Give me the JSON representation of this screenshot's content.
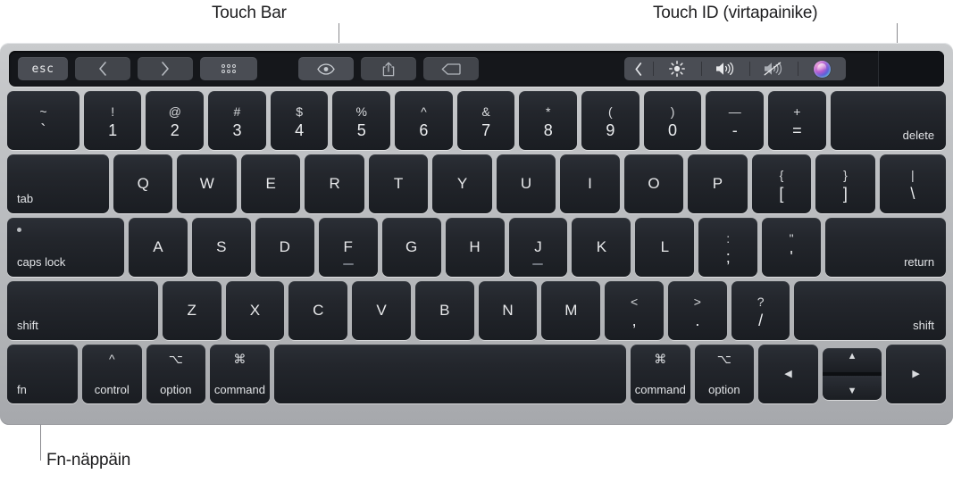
{
  "callouts": {
    "touch_bar": "Touch Bar",
    "touch_id": "Touch ID (virtapainike)",
    "fn_key": "Fn-näppäin"
  },
  "touch_bar": {
    "esc_label": "esc",
    "back_icon": "chevron-left-icon",
    "forward_icon": "chevron-right-icon",
    "grid_icon": "app-grid-icon",
    "preview_icon": "eye-icon",
    "share_icon": "share-icon",
    "tag_icon": "tag-icon",
    "control_strip": {
      "expand_icon": "chevron-left-icon",
      "brightness_icon": "brightness-icon",
      "volume_icon": "volume-up-icon",
      "mute_icon": "volume-mute-icon",
      "siri_icon": "siri-orb-icon"
    },
    "touch_id_region": "touch-id-sensor"
  },
  "keyboard": {
    "rows": [
      {
        "name": "number-row",
        "keys": [
          {
            "name": "key-grave",
            "type": "dual",
            "top": "~",
            "bot": "`",
            "width": "w-tilde"
          },
          {
            "name": "key-1",
            "type": "dual",
            "top": "!",
            "bot": "1"
          },
          {
            "name": "key-2",
            "type": "dual",
            "top": "@",
            "bot": "2"
          },
          {
            "name": "key-3",
            "type": "dual",
            "top": "#",
            "bot": "3"
          },
          {
            "name": "key-4",
            "type": "dual",
            "top": "$",
            "bot": "4"
          },
          {
            "name": "key-5",
            "type": "dual",
            "top": "%",
            "bot": "5"
          },
          {
            "name": "key-6",
            "type": "dual",
            "top": "^",
            "bot": "6"
          },
          {
            "name": "key-7",
            "type": "dual",
            "top": "&",
            "bot": "7"
          },
          {
            "name": "key-8",
            "type": "dual",
            "top": "*",
            "bot": "8"
          },
          {
            "name": "key-9",
            "type": "dual",
            "top": "(",
            "bot": "9"
          },
          {
            "name": "key-0",
            "type": "dual",
            "top": ")",
            "bot": "0"
          },
          {
            "name": "key-minus",
            "type": "dual",
            "top": "—",
            "bot": "-"
          },
          {
            "name": "key-equal",
            "type": "dual",
            "top": "+",
            "bot": "="
          },
          {
            "name": "key-delete",
            "type": "corner-br",
            "label": "delete",
            "width": "w-delete"
          }
        ]
      },
      {
        "name": "qwerty-row",
        "keys": [
          {
            "name": "key-tab",
            "type": "corner-bl",
            "label": "tab",
            "width": "w-tab"
          },
          {
            "name": "key-q",
            "type": "letter",
            "label": "Q"
          },
          {
            "name": "key-w",
            "type": "letter",
            "label": "W"
          },
          {
            "name": "key-e",
            "type": "letter",
            "label": "E"
          },
          {
            "name": "key-r",
            "type": "letter",
            "label": "R"
          },
          {
            "name": "key-t",
            "type": "letter",
            "label": "T"
          },
          {
            "name": "key-y",
            "type": "letter",
            "label": "Y"
          },
          {
            "name": "key-u",
            "type": "letter",
            "label": "U"
          },
          {
            "name": "key-i",
            "type": "letter",
            "label": "I"
          },
          {
            "name": "key-o",
            "type": "letter",
            "label": "O"
          },
          {
            "name": "key-p",
            "type": "letter",
            "label": "P"
          },
          {
            "name": "key-bracket-left",
            "type": "dual",
            "top": "{",
            "bot": "["
          },
          {
            "name": "key-bracket-right",
            "type": "dual",
            "top": "}",
            "bot": "]"
          },
          {
            "name": "key-backslash",
            "type": "dual",
            "top": "|",
            "bot": "\\",
            "width": "w-bslash"
          }
        ]
      },
      {
        "name": "home-row",
        "keys": [
          {
            "name": "key-caps-lock",
            "type": "caps",
            "label": "caps lock",
            "width": "w-caps"
          },
          {
            "name": "key-a",
            "type": "letter",
            "label": "A"
          },
          {
            "name": "key-s",
            "type": "letter",
            "label": "S"
          },
          {
            "name": "key-d",
            "type": "letter",
            "label": "D"
          },
          {
            "name": "key-f",
            "type": "letter",
            "label": "F",
            "homing": true
          },
          {
            "name": "key-g",
            "type": "letter",
            "label": "G"
          },
          {
            "name": "key-h",
            "type": "letter",
            "label": "H"
          },
          {
            "name": "key-j",
            "type": "letter",
            "label": "J",
            "homing": true
          },
          {
            "name": "key-k",
            "type": "letter",
            "label": "K"
          },
          {
            "name": "key-l",
            "type": "letter",
            "label": "L"
          },
          {
            "name": "key-semicolon",
            "type": "dual",
            "top": ":",
            "bot": ";"
          },
          {
            "name": "key-quote",
            "type": "dual",
            "top": "\"",
            "bot": "'"
          },
          {
            "name": "key-return",
            "type": "corner-br",
            "label": "return",
            "width": "w-return"
          }
        ]
      },
      {
        "name": "shift-row",
        "keys": [
          {
            "name": "key-shift-left",
            "type": "corner-bl",
            "label": "shift",
            "width": "w-shiftL"
          },
          {
            "name": "key-z",
            "type": "letter",
            "label": "Z"
          },
          {
            "name": "key-x",
            "type": "letter",
            "label": "X"
          },
          {
            "name": "key-c",
            "type": "letter",
            "label": "C"
          },
          {
            "name": "key-v",
            "type": "letter",
            "label": "V"
          },
          {
            "name": "key-b",
            "type": "letter",
            "label": "B"
          },
          {
            "name": "key-n",
            "type": "letter",
            "label": "N"
          },
          {
            "name": "key-m",
            "type": "letter",
            "label": "M"
          },
          {
            "name": "key-comma",
            "type": "dual",
            "top": "<",
            "bot": ","
          },
          {
            "name": "key-period",
            "type": "dual",
            "top": ">",
            "bot": "."
          },
          {
            "name": "key-slash",
            "type": "dual",
            "top": "?",
            "bot": "/"
          },
          {
            "name": "key-shift-right",
            "type": "corner-br",
            "label": "shift",
            "width": "w-shiftR"
          }
        ]
      },
      {
        "name": "bottom-row",
        "keys": [
          {
            "name": "key-fn",
            "type": "mod",
            "sym": "",
            "word": "fn",
            "width": "w-fn",
            "align": "bl"
          },
          {
            "name": "key-control",
            "type": "mod",
            "sym": "^",
            "word": "control"
          },
          {
            "name": "key-option-left",
            "type": "mod",
            "sym": "⌥",
            "word": "option"
          },
          {
            "name": "key-command-left",
            "type": "mod",
            "sym": "⌘",
            "word": "command"
          },
          {
            "name": "key-space",
            "type": "blank",
            "label": "",
            "width": "w-space"
          },
          {
            "name": "key-command-right",
            "type": "mod",
            "sym": "⌘",
            "word": "command"
          },
          {
            "name": "key-option-right",
            "type": "mod",
            "sym": "⌥",
            "word": "option"
          },
          {
            "name": "key-arrow-left",
            "type": "arrow",
            "glyph": "◀",
            "width": "w-arrowlr"
          },
          {
            "name": "key-arrow-updown",
            "type": "updown",
            "up": "▲",
            "down": "▼"
          },
          {
            "name": "key-arrow-right",
            "type": "arrow",
            "glyph": "▶",
            "width": "w-arrowlr"
          }
        ]
      }
    ]
  }
}
